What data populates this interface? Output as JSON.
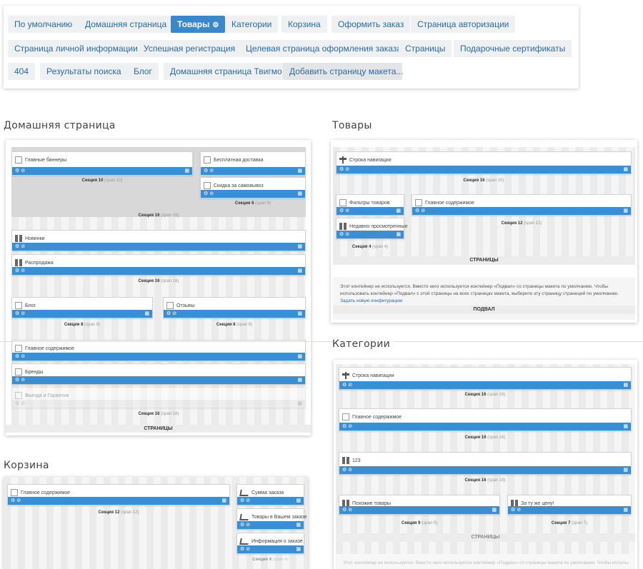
{
  "tabs": [
    {
      "label": "По умолчанию",
      "active": false
    },
    {
      "label": "Домашняя страница",
      "active": false
    },
    {
      "label": "Товары",
      "active": true
    },
    {
      "label": "Категории",
      "active": false
    },
    {
      "label": "Корзина",
      "active": false
    },
    {
      "label": "Оформить заказ",
      "active": false
    },
    {
      "label": "Страница авторизации",
      "active": false
    },
    {
      "label": "Страница личной информации",
      "active": false
    },
    {
      "label": "Успешная регистрация",
      "active": false
    },
    {
      "label": "Целевая страница оформления заказа",
      "active": false
    },
    {
      "label": "Страницы",
      "active": false
    },
    {
      "label": "Подарочные сертификаты",
      "active": false
    },
    {
      "label": "404",
      "active": false
    },
    {
      "label": "Результаты поиска",
      "active": false
    },
    {
      "label": "Блог",
      "active": false
    },
    {
      "label": "Домашняя страница Твигмо",
      "active": false
    },
    {
      "label": "Добавить страницу макета...",
      "active": false
    }
  ],
  "icons": {
    "settings": "gear-icon",
    "bar_left": "⚙ ⊘",
    "bar_right": "▦"
  },
  "colors": {
    "accent": "#3a87cc",
    "module_bar": "#3a8fd4"
  },
  "home": {
    "title": "Домашняя страница",
    "modules": {
      "main_banners": "Главные баннеры",
      "free_delivery": "Бесплатная доставка",
      "pickup_discount": "Скидка за самовывоз",
      "new_items": "Новинки",
      "sale": "Распродажа",
      "blog": "Блог",
      "reviews": "Отзывы",
      "main_content": "Главное содержимое",
      "brands": "Бренды",
      "benefits": "Выгода и Гарантия"
    },
    "sections": {
      "s10": "Секция 10",
      "s10_span": "(span 10)",
      "s6": "Секция 6",
      "s6_span": "(span 6)",
      "s16": "Секция 16",
      "s16_span": "(span 16)",
      "s8": "Секция 8",
      "s8_span": "(span 8)"
    },
    "footer": "СТРАНИЦЫ"
  },
  "products": {
    "title": "Товары",
    "modules": {
      "breadcrumbs": "Строка навигации",
      "filters": "Фильтры товаров",
      "recent": "Недавно просмотренные",
      "main_content": "Главное содержимое"
    },
    "sections": {
      "s16": "Секция 16",
      "s16_span": "(span 16)",
      "s4": "Секция 4",
      "s4_span": "(span 4)",
      "s12": "Секция 12",
      "s12_span": "(span 12)"
    },
    "pages": "СТРАНИЦЫ",
    "note": "Этот контейнер не используется. Вместо него используется контейнер «Подвал» со страницы макета по умолчанию. Чтобы использовать контейнер «Подвал» с этой страницы на всех страницах макета, выберите эту страницу страницей по умолчанию.",
    "note_link": "Задать новую конфигурацию",
    "footer": "ПОДВАЛ"
  },
  "cart": {
    "title": "Корзина",
    "modules": {
      "main_content": "Главное содержимое",
      "order_sum": "Сумма заказа",
      "order_items": "Товары в Вашем заказе",
      "order_info": "Информация о заказе"
    },
    "sections": {
      "s12": "Секция 12",
      "s12_span": "(span 12)",
      "s4": "Секция 4",
      "s4_span": "(span 4)"
    }
  },
  "categories": {
    "title": "Категории",
    "modules": {
      "breadcrumbs": "Строка навигации",
      "main_content": "Главное содержимое",
      "m123": "123",
      "similar": "Похожие товары",
      "same_price": "За ту же цену!"
    },
    "sections": {
      "s16": "Секция 16",
      "s16_span": "(span 16)",
      "s9": "Секция 9",
      "s9_span": "(span 9)",
      "s7": "Секция 7",
      "s7_span": "(span 7)"
    },
    "pages": "СТРАНИЦЫ",
    "note": "Этот контейнер не используется. Вместо него используется контейнер «Подвал» со страницы макета по умолчанию. Чтобы использовать"
  }
}
